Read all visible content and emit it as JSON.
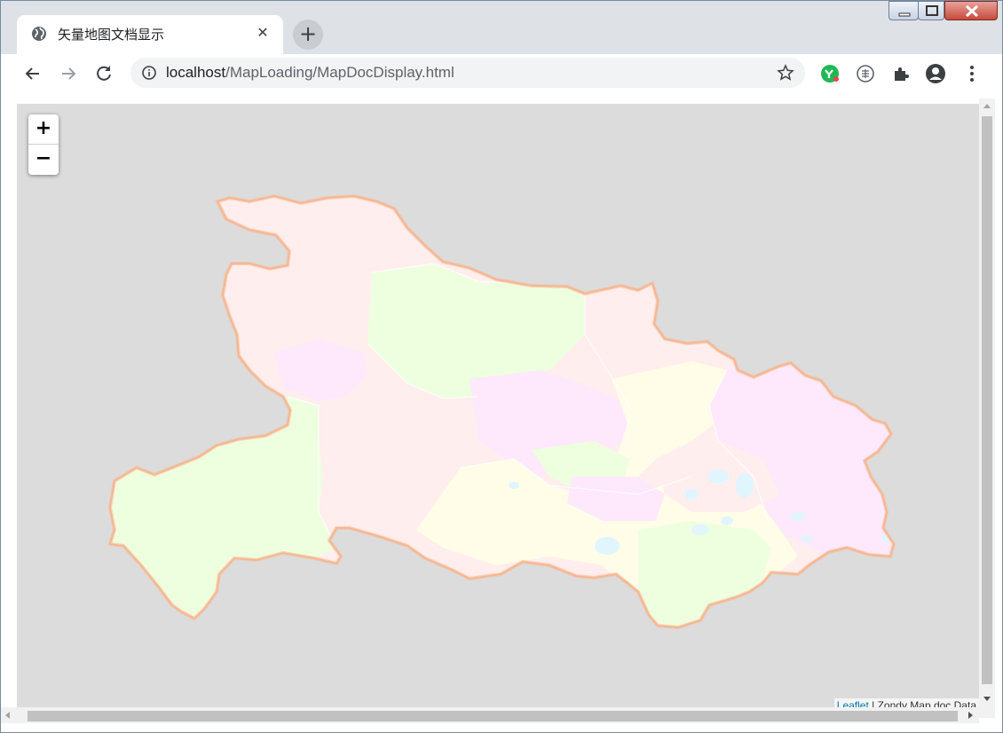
{
  "browser": {
    "tab": {
      "title": "矢量地图文档显示",
      "favicon": "globe-icon"
    },
    "address": {
      "host": "localhost",
      "path": "/MapLoading/MapDocDisplay.html"
    }
  },
  "map": {
    "zoom_in_label": "+",
    "zoom_out_label": "−",
    "attribution": {
      "link": "Leaflet",
      "separator": " | ",
      "text": "Zondy Map doc Data"
    },
    "background_color": "#dcdcdc",
    "region_border_color": "#f7b48c",
    "region_colors": [
      "#ffeeed",
      "#eeffe0",
      "#fde9fb",
      "#fffde8",
      "#e0f5ff"
    ]
  }
}
